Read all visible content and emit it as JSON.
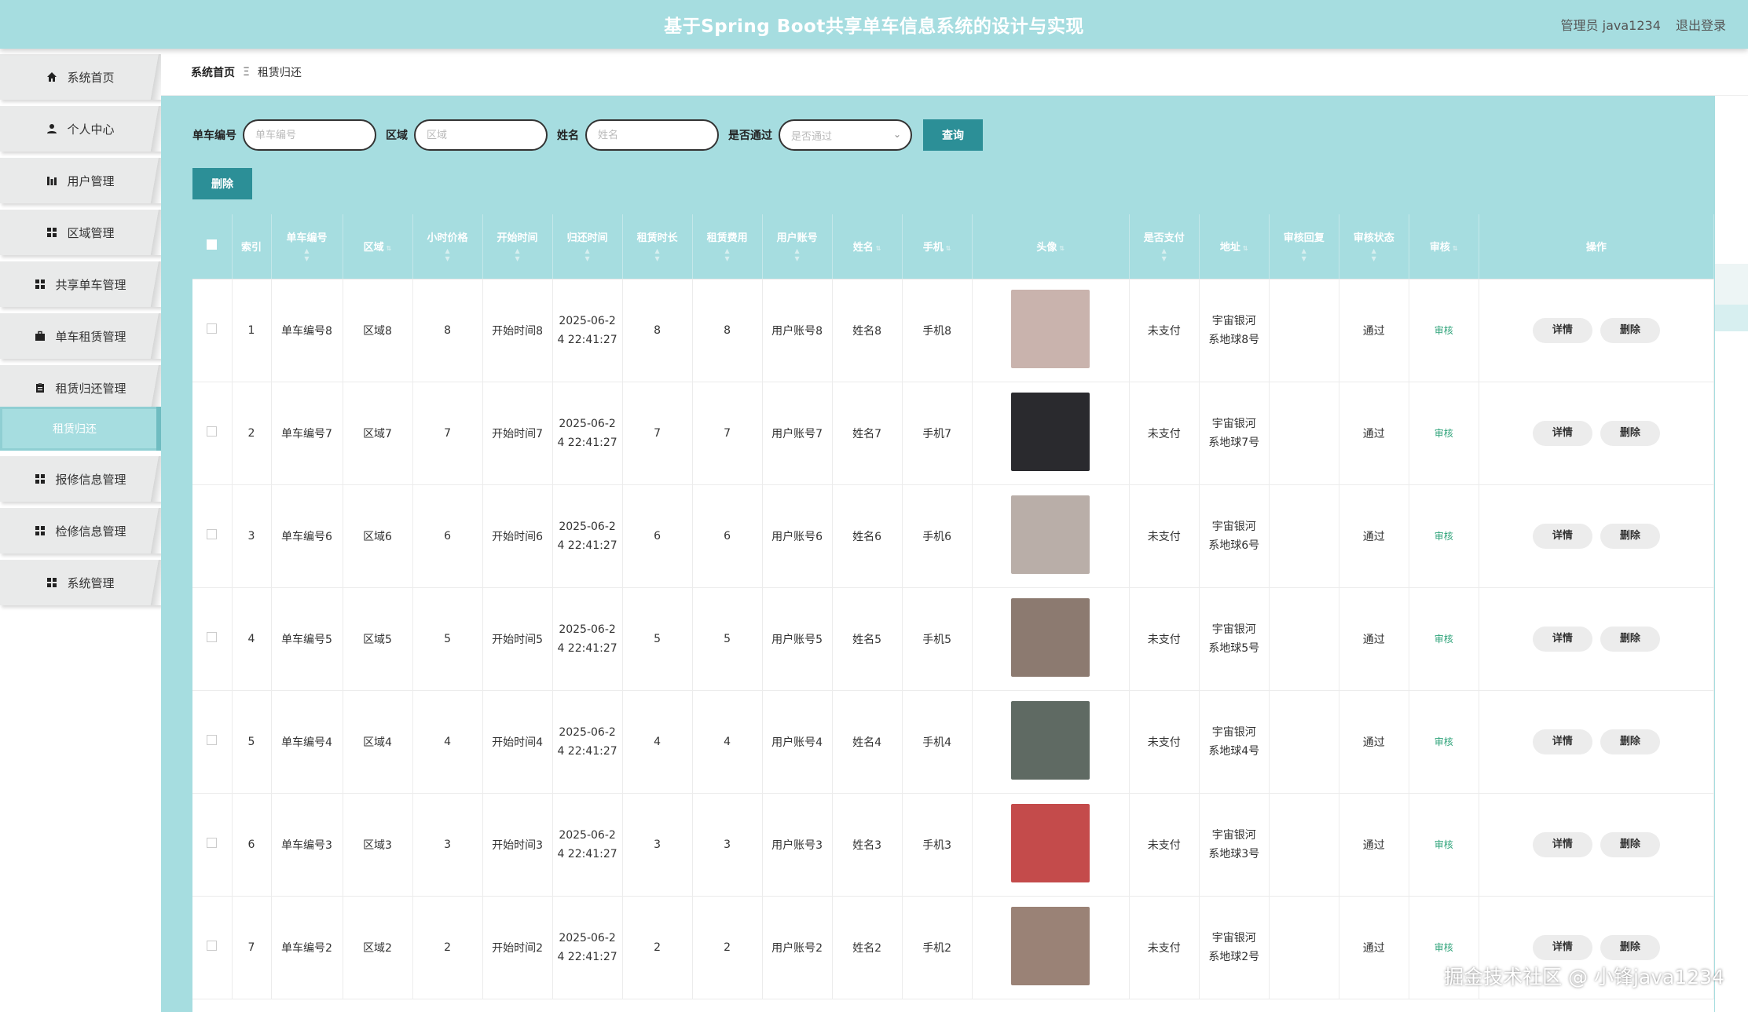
{
  "header": {
    "title": "基于Spring Boot共享单车信息系统的设计与实现",
    "user_label": "管理员 java1234",
    "logout_label": "退出登录"
  },
  "sidebar": {
    "items": [
      {
        "label": "系统首页",
        "icon": "home-icon"
      },
      {
        "label": "个人中心",
        "icon": "user-icon"
      },
      {
        "label": "用户管理",
        "icon": "chart-icon"
      },
      {
        "label": "区域管理",
        "icon": "grid-icon"
      },
      {
        "label": "共享单车管理",
        "icon": "grid-icon"
      },
      {
        "label": "单车租赁管理",
        "icon": "briefcase-icon"
      },
      {
        "label": "租赁归还管理",
        "icon": "clipboard-icon"
      },
      {
        "label": "报修信息管理",
        "icon": "grid-icon"
      },
      {
        "label": "检修信息管理",
        "icon": "grid-icon"
      },
      {
        "label": "系统管理",
        "icon": "grid-icon"
      }
    ],
    "active_sub": "租赁归还"
  },
  "breadcrumb": {
    "home": "系统首页",
    "separator": "Ξ",
    "current": "租赁归还"
  },
  "search": {
    "bike_no_label": "单车编号",
    "bike_no_placeholder": "单车编号",
    "area_label": "区域",
    "area_placeholder": "区域",
    "name_label": "姓名",
    "name_placeholder": "姓名",
    "pass_label": "是否通过",
    "pass_placeholder": "是否通过",
    "search_button": "查询",
    "delete_button": "删除"
  },
  "table": {
    "columns": [
      "索引",
      "单车编号",
      "区域",
      "小时价格",
      "开始时间",
      "归还时间",
      "租赁时长",
      "租赁费用",
      "用户账号",
      "姓名",
      "手机",
      "头像",
      "是否支付",
      "地址",
      "审核回复",
      "审核状态",
      "审核",
      "操作"
    ],
    "detail_label": "详情",
    "delete_label": "删除",
    "audit_label": "审核",
    "rows": [
      {
        "index": "1",
        "bike_no": "单车编号8",
        "area": "区域8",
        "price": "8",
        "start": "开始时间8",
        "return_a": "2025-06-2",
        "return_b": "4 22:41:27",
        "duration": "8",
        "fee": "8",
        "account": "用户账号8",
        "name": "姓名8",
        "phone": "手机8",
        "paid": "未支付",
        "addr_a": "宇宙银河",
        "addr_b": "系地球8号",
        "reply": "",
        "status": "通过",
        "avatar_color": "#c9b3ad"
      },
      {
        "index": "2",
        "bike_no": "单车编号7",
        "area": "区域7",
        "price": "7",
        "start": "开始时间7",
        "return_a": "2025-06-2",
        "return_b": "4 22:41:27",
        "duration": "7",
        "fee": "7",
        "account": "用户账号7",
        "name": "姓名7",
        "phone": "手机7",
        "paid": "未支付",
        "addr_a": "宇宙银河",
        "addr_b": "系地球7号",
        "reply": "",
        "status": "通过",
        "avatar_color": "#2a2a2e"
      },
      {
        "index": "3",
        "bike_no": "单车编号6",
        "area": "区域6",
        "price": "6",
        "start": "开始时间6",
        "return_a": "2025-06-2",
        "return_b": "4 22:41:27",
        "duration": "6",
        "fee": "6",
        "account": "用户账号6",
        "name": "姓名6",
        "phone": "手机6",
        "paid": "未支付",
        "addr_a": "宇宙银河",
        "addr_b": "系地球6号",
        "reply": "",
        "status": "通过",
        "avatar_color": "#b9aea8"
      },
      {
        "index": "4",
        "bike_no": "单车编号5",
        "area": "区域5",
        "price": "5",
        "start": "开始时间5",
        "return_a": "2025-06-2",
        "return_b": "4 22:41:27",
        "duration": "5",
        "fee": "5",
        "account": "用户账号5",
        "name": "姓名5",
        "phone": "手机5",
        "paid": "未支付",
        "addr_a": "宇宙银河",
        "addr_b": "系地球5号",
        "reply": "",
        "status": "通过",
        "avatar_color": "#8c7a70"
      },
      {
        "index": "5",
        "bike_no": "单车编号4",
        "area": "区域4",
        "price": "4",
        "start": "开始时间4",
        "return_a": "2025-06-2",
        "return_b": "4 22:41:27",
        "duration": "4",
        "fee": "4",
        "account": "用户账号4",
        "name": "姓名4",
        "phone": "手机4",
        "paid": "未支付",
        "addr_a": "宇宙银河",
        "addr_b": "系地球4号",
        "reply": "",
        "status": "通过",
        "avatar_color": "#5f6a63"
      },
      {
        "index": "6",
        "bike_no": "单车编号3",
        "area": "区域3",
        "price": "3",
        "start": "开始时间3",
        "return_a": "2025-06-2",
        "return_b": "4 22:41:27",
        "duration": "3",
        "fee": "3",
        "account": "用户账号3",
        "name": "姓名3",
        "phone": "手机3",
        "paid": "未支付",
        "addr_a": "宇宙银河",
        "addr_b": "系地球3号",
        "reply": "",
        "status": "通过",
        "avatar_color": "#c44b4b"
      },
      {
        "index": "7",
        "bike_no": "单车编号2",
        "area": "区域2",
        "price": "2",
        "start": "开始时间2",
        "return_a": "2025-06-2",
        "return_b": "4 22:41:27",
        "duration": "2",
        "fee": "2",
        "account": "用户账号2",
        "name": "姓名2",
        "phone": "手机2",
        "paid": "未支付",
        "addr_a": "宇宙银河",
        "addr_b": "系地球2号",
        "reply": "",
        "status": "通过",
        "avatar_color": "#9a8276"
      }
    ]
  },
  "watermark": "掘金技术社区 @ 小锋java1234",
  "colors": {
    "accent": "#a6dde0",
    "button": "#2c8f97",
    "audit_link": "#2fa37a"
  }
}
